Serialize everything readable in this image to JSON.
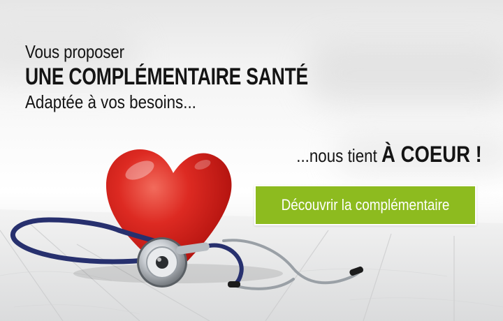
{
  "banner": {
    "headline": {
      "line1": "Vous proposer",
      "line2": "UNE COMPLÉMENTAIRE SANTÉ",
      "line3": "Adaptée à  vos besoins..."
    },
    "tagline": {
      "prefix": "...nous tient ",
      "emphasis": "À COEUR !"
    },
    "cta_label": "Découvrir la complémentaire",
    "colors": {
      "cta_background": "#8dbb1f",
      "text": "#141414",
      "heart": "#d8231f",
      "stethoscope_tube": "#27306e"
    },
    "icons": [
      "heart-icon",
      "stethoscope-icon"
    ]
  }
}
